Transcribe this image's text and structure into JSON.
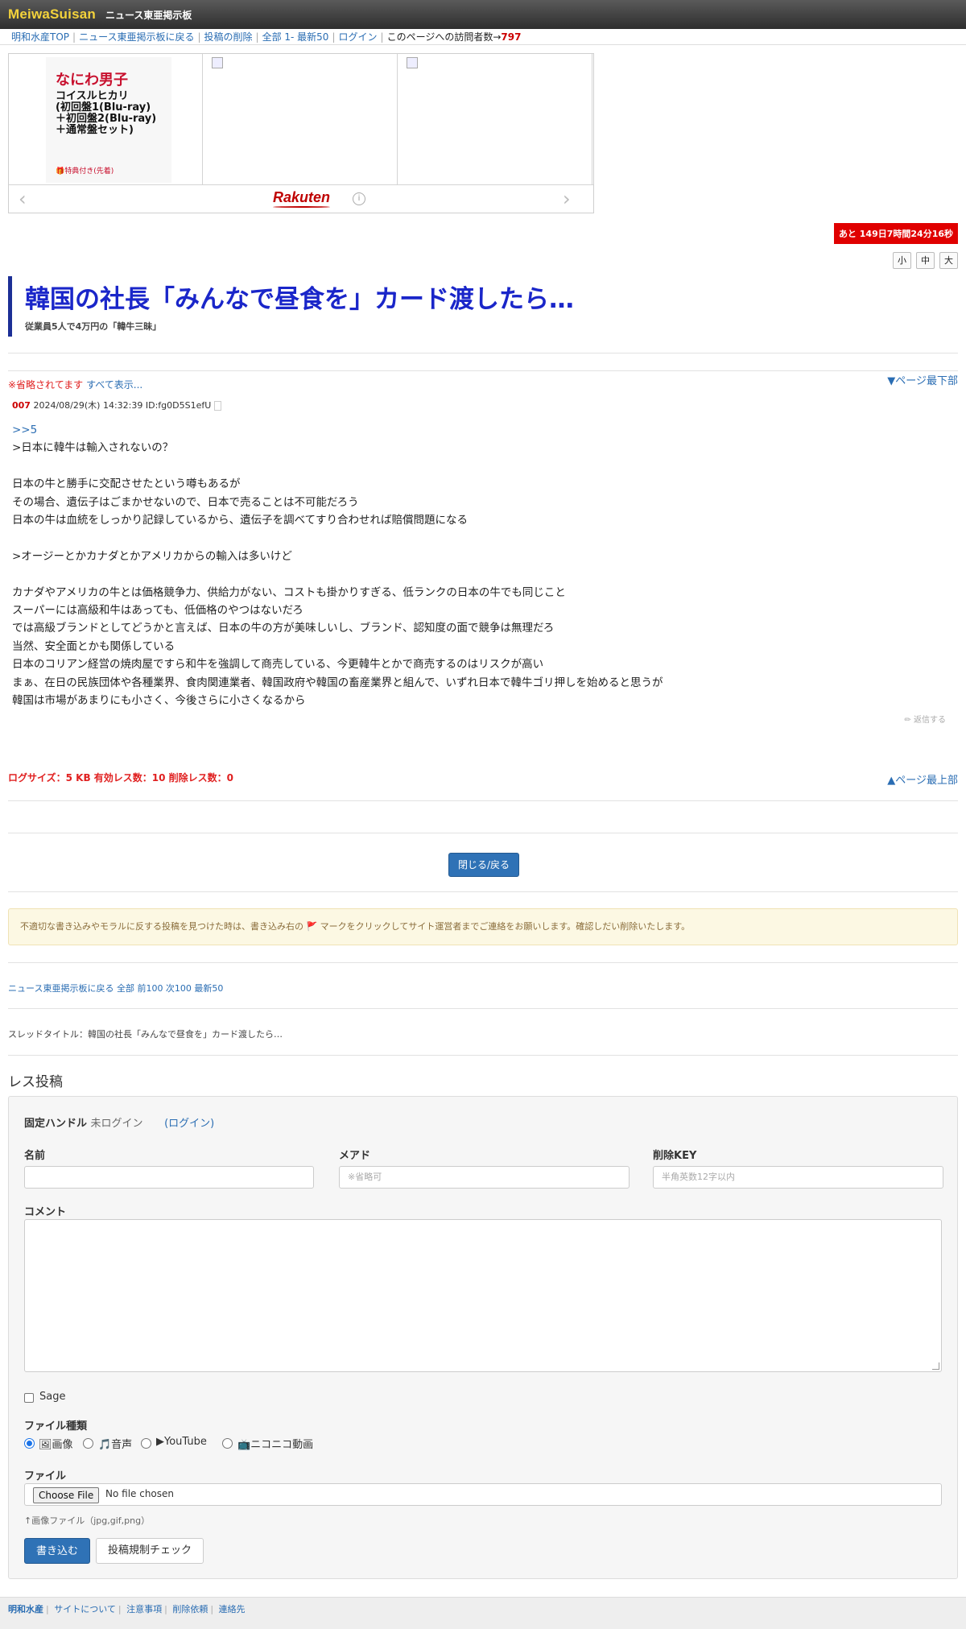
{
  "header": {
    "logo": "MeiwaSuisan",
    "board_name": "ニュース東亜掲示板"
  },
  "nav": {
    "items": [
      "明和水産TOP",
      "ニュース東亜掲示板に戻る",
      "投稿の削除",
      "全部 1- 最新50",
      "ログイン"
    ],
    "visitor_label": "このページへの訪問者数→",
    "visitor_count": "797"
  },
  "ad": {
    "title": "なにわ男子",
    "subtitle": "コイスルヒカリ\n(初回盤1(Blu-ray)\n＋初回盤2(Blu-ray)\n＋通常盤セット)",
    "badge": "🎁特典付き(先着)",
    "brand": "Rakuten",
    "info": "i",
    "prev": "‹",
    "next": "›"
  },
  "countdown": "あと 149日7時間24分16秒",
  "font_sizes": [
    "小",
    "中",
    "大"
  ],
  "thread": {
    "title": "韓国の社長「みんなで昼食を」カード渡したら…",
    "subtitle": "従業員5人で4万円の「韓牛三昧」"
  },
  "omit": {
    "text": "※省略されてます",
    "show_all": "すべて表示..."
  },
  "to_bottom": "▼ページ最下部",
  "to_top": "▲ページ最上部",
  "post": {
    "number": "007",
    "meta": "2024/08/29(木) 14:32:39 ID:fg0D5S1efU",
    "anchor": ">>5",
    "body": ">日本に韓牛は輸入されないの？\n\n日本の牛と勝手に交配させたという噂もあるが\nその場合、遺伝子はごまかせないので、日本で売ることは不可能だろう\n日本の牛は血統をしっかり記録しているから、遺伝子を調べてすり合わせれば賠償問題になる\n\n>オージーとかカナダとかアメリカからの輸入は多いけど\n\nカナダやアメリカの牛とは価格競争力、供給力がない、コストも掛かりすぎる、低ランクの日本の牛でも同じこと\nスーパーには高級和牛はあっても、低価格のやつはないだろ\nでは高級ブランドとしてどうかと言えば、日本の牛の方が美味しいし、ブランド、認知度の面で競争は無理だろ\n当然、安全面とかも関係している\n日本のコリアン経営の焼肉屋ですら和牛を強調して商売している、今更韓牛とかで商売するのはリスクが高い\nまぁ、在日の民族団体や各種業界、食肉関連業者、韓国政府や韓国の畜産業界と組んで、いずれ日本で韓牛ゴリ押しを始めると思うが\n韓国は市場があまりにも小さく、今後さらに小さくなるから",
    "reply": "✏ 返信する"
  },
  "log_info": "ログサイズ：5 KB 有効レス数：10 削除レス数：0",
  "close_button": "閉じる/戻る",
  "notice": "不適切な書き込みやモラルに反する投稿を見つけた時は、書き込み右の 🚩 マークをクリックしてサイト運営者までご連絡をお願いします。確認しだい削除いたします。",
  "bottom_nav": "ニュース東亜掲示板に戻る 全部 前100 次100 最新50",
  "thread_title_line": "スレッドタイトル：韓国の社長「みんなで昼食を」カード渡したら…",
  "form": {
    "heading": "レス投稿",
    "handle_label": "固定ハンドル",
    "handle_status": "未ログイン",
    "login_link": "(ログイン)",
    "name_label": "名前",
    "email_label": "メアド",
    "email_placeholder": "※省略可",
    "delkey_label": "削除KEY",
    "delkey_placeholder": "半角英数12字以内",
    "comment_label": "コメント",
    "sage_label": "Sage",
    "filetype_label": "ファイル種類",
    "filetypes": [
      "🖼画像",
      "🎵音声",
      "▶YouTube",
      "📺ニコニコ動画"
    ],
    "file_label": "ファイル",
    "choose_file": "Choose File",
    "no_file": "No file chosen",
    "file_hint": "↑画像ファイル（jpg,gif,png）",
    "submit": "書き込む",
    "check": "投稿規制チェック"
  },
  "footer": {
    "items": [
      "明和水産",
      "サイトについて",
      "注意事項",
      "削除依頼",
      "連絡先"
    ]
  }
}
